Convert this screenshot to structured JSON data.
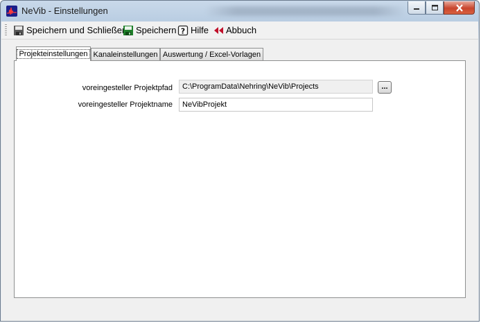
{
  "window": {
    "title": "NeVib - Einstellungen",
    "obscured_title": "Messungen zum Projekt hinzufügen / ...",
    "icons": {
      "app": "waveform-icon",
      "minimize": "minimize-icon",
      "maximize": "restore-icon",
      "close": "close-icon"
    }
  },
  "toolbar": {
    "save_close_label": "Speichern und Schließen",
    "save_label": "Speichern",
    "help_label": "Hilfe",
    "cancel_label": "Abbuch"
  },
  "tabs": [
    {
      "label": "Projekteinstellungen",
      "active": true
    },
    {
      "label": "Kanaleinstellungen",
      "active": false
    },
    {
      "label": "Auswertung / Excel-Vorlagen",
      "active": false
    }
  ],
  "settings": {
    "path_label": "voreingesteller Projektpfad",
    "path_value": "C:\\ProgramData\\Nehring\\NeVib\\Projects",
    "browse_label": "...",
    "name_label": "voreingesteller Projektname",
    "name_value": "NeVibProjekt"
  },
  "colors": {
    "accent_title": "#c9d9ea",
    "close_button": "#c8452d",
    "panel_bg": "#ffffff"
  }
}
